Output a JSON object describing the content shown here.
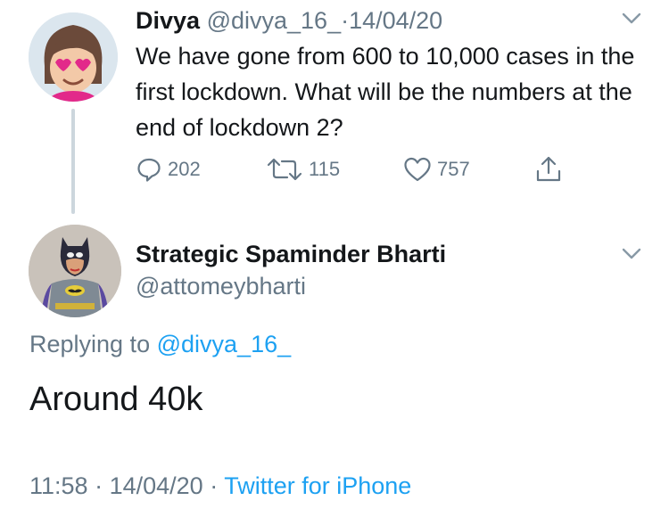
{
  "tweet1": {
    "name": "Divya",
    "handle": "@divya_16_",
    "separator": "·",
    "date": "14/04/20",
    "text": "We have gone from 600 to 10,000 cases in the first lockdown. What will be the numbers at the end of lockdown 2?",
    "replies": "202",
    "retweets": "115",
    "likes": "757"
  },
  "tweet2": {
    "name": "Strategic Spaminder Bharti",
    "handle": "@attomeybharti",
    "replying_prefix": "Replying to",
    "replying_handle": "@divya_16_",
    "text": "Around 40k",
    "time": "11:58",
    "separator": "·",
    "date": "14/04/20",
    "source": "Twitter for iPhone"
  },
  "colors": {
    "text": "#14171a",
    "muted": "#657786",
    "link": "#1da1f2",
    "thread_line": "#ccd6dd"
  },
  "icons": [
    "reply-icon",
    "retweet-icon",
    "like-icon",
    "share-icon",
    "chevron-down-icon"
  ]
}
